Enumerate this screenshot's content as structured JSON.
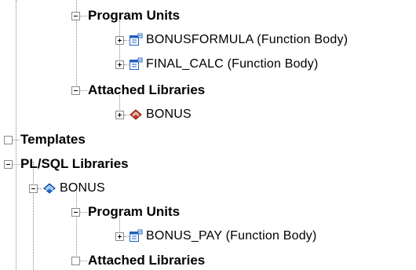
{
  "tree": [
    {
      "id": "program-units-1",
      "label": "Program Units",
      "bold": true,
      "level": 5,
      "toggle": "minus"
    },
    {
      "id": "bonusformula",
      "label": "BONUSFORMULA (Function Body)",
      "bold": false,
      "level": 6,
      "toggle": "plus",
      "icon": "function-body-icon"
    },
    {
      "id": "final-calc",
      "label": "FINAL_CALC (Function Body)",
      "bold": false,
      "level": 6,
      "toggle": "plus",
      "icon": "function-body-icon"
    },
    {
      "id": "attached-libraries-1",
      "label": "Attached Libraries",
      "bold": true,
      "level": 5,
      "toggle": "minus"
    },
    {
      "id": "bonus-attached",
      "label": "BONUS",
      "bold": false,
      "level": 6,
      "toggle": "plus",
      "icon": "attached-library-icon"
    },
    {
      "id": "templates",
      "label": "Templates",
      "bold": true,
      "level": 1,
      "toggle": "empty"
    },
    {
      "id": "plsql-libraries",
      "label": "PL/SQL Libraries",
      "bold": true,
      "level": 1,
      "toggle": "minus"
    },
    {
      "id": "bonus-library",
      "label": "BONUS",
      "bold": false,
      "level": 2,
      "toggle": "minus",
      "icon": "plsql-library-icon"
    },
    {
      "id": "program-units-2",
      "label": "Program Units",
      "bold": true,
      "level": 5,
      "toggle": "minus"
    },
    {
      "id": "bonus-pay",
      "label": "BONUS_PAY (Function Body)",
      "bold": false,
      "level": 6,
      "toggle": "plus",
      "icon": "function-body-icon"
    },
    {
      "id": "attached-libraries-2",
      "label": "Attached Libraries",
      "bold": true,
      "level": 5,
      "toggle": "empty"
    }
  ],
  "colors": {
    "connector": "#8a8a8a",
    "function_icon": "#1f5fbf",
    "attached_library_icon": "#c0392b",
    "plsql_library_icon": "#1c6fd0"
  }
}
